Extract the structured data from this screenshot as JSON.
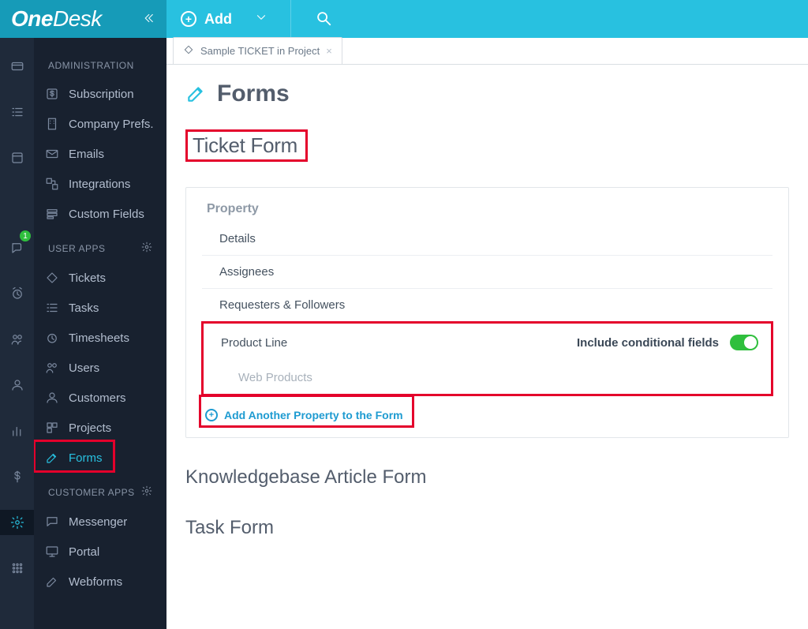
{
  "header": {
    "brand": "OneDesk",
    "add_label": "Add"
  },
  "iconbar": {
    "badge_count": "1"
  },
  "sidebar": {
    "section_admin": "ADMINISTRATION",
    "section_user": "USER APPS",
    "section_customer": "CUSTOMER APPS",
    "admin": [
      {
        "label": "Subscription",
        "name": "nav-subscription"
      },
      {
        "label": "Company Prefs.",
        "name": "nav-company-prefs"
      },
      {
        "label": "Emails",
        "name": "nav-emails"
      },
      {
        "label": "Integrations",
        "name": "nav-integrations"
      },
      {
        "label": "Custom Fields",
        "name": "nav-custom-fields"
      }
    ],
    "user": [
      {
        "label": "Tickets",
        "name": "nav-tickets"
      },
      {
        "label": "Tasks",
        "name": "nav-tasks"
      },
      {
        "label": "Timesheets",
        "name": "nav-timesheets"
      },
      {
        "label": "Users",
        "name": "nav-users"
      },
      {
        "label": "Customers",
        "name": "nav-customers"
      },
      {
        "label": "Projects",
        "name": "nav-projects"
      },
      {
        "label": "Forms",
        "name": "nav-forms",
        "active": true
      }
    ],
    "customer": [
      {
        "label": "Messenger",
        "name": "nav-messenger"
      },
      {
        "label": "Portal",
        "name": "nav-portal"
      },
      {
        "label": "Webforms",
        "name": "nav-webforms"
      }
    ]
  },
  "tabs": {
    "label": "Sample TICKET in Project"
  },
  "page": {
    "title": "Forms",
    "section1": "Ticket Form",
    "property_header": "Property",
    "properties": [
      "Details",
      "Assignees",
      "Requesters & Followers"
    ],
    "cond_property": "Product Line",
    "cond_label": "Include conditional fields",
    "cond_sub": "Web Products",
    "add_property": "Add Another Property to the Form",
    "section2": "Knowledgebase Article Form",
    "section3": "Task Form"
  }
}
